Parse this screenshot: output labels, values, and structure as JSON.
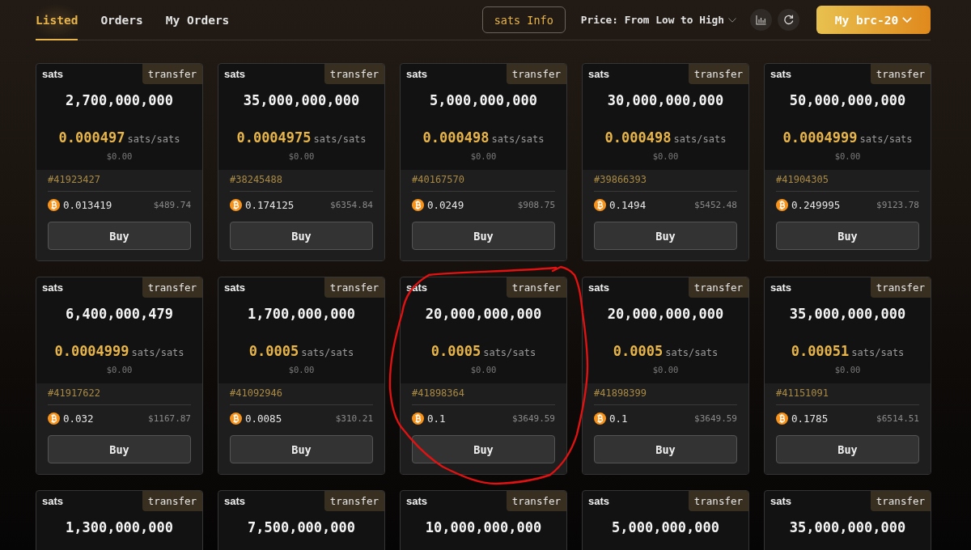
{
  "tabs": [
    {
      "label": "Listed",
      "selected": true
    },
    {
      "label": "Orders",
      "selected": false
    },
    {
      "label": "My Orders",
      "selected": false
    }
  ],
  "toolbar": {
    "info_button": "sats Info",
    "sort_label": "Price: From Low to High",
    "wallet_button": "My brc-20"
  },
  "cards": [
    {
      "ticker": "sats",
      "tag": "transfer",
      "amount": "2,700,000,000",
      "price": "0.000497",
      "unit": "sats/sats",
      "usd_price": "$0.00",
      "inscription": "#41923427",
      "btc_price": "0.013419",
      "usd_total": "$489.74",
      "button": "Buy",
      "annotated": false
    },
    {
      "ticker": "sats",
      "tag": "transfer",
      "amount": "35,000,000,000",
      "price": "0.0004975",
      "unit": "sats/sats",
      "usd_price": "$0.00",
      "inscription": "#38245488",
      "btc_price": "0.174125",
      "usd_total": "$6354.84",
      "button": "Buy",
      "annotated": false
    },
    {
      "ticker": "sats",
      "tag": "transfer",
      "amount": "5,000,000,000",
      "price": "0.000498",
      "unit": "sats/sats",
      "usd_price": "$0.00",
      "inscription": "#40167570",
      "btc_price": "0.0249",
      "usd_total": "$908.75",
      "button": "Buy",
      "annotated": false
    },
    {
      "ticker": "sats",
      "tag": "transfer",
      "amount": "30,000,000,000",
      "price": "0.000498",
      "unit": "sats/sats",
      "usd_price": "$0.00",
      "inscription": "#39866393",
      "btc_price": "0.1494",
      "usd_total": "$5452.48",
      "button": "Buy",
      "annotated": false
    },
    {
      "ticker": "sats",
      "tag": "transfer",
      "amount": "50,000,000,000",
      "price": "0.0004999",
      "unit": "sats/sats",
      "usd_price": "$0.00",
      "inscription": "#41904305",
      "btc_price": "0.249995",
      "usd_total": "$9123.78",
      "button": "Buy",
      "annotated": false
    },
    {
      "ticker": "sats",
      "tag": "transfer",
      "amount": "6,400,000,479",
      "price": "0.0004999",
      "unit": "sats/sats",
      "usd_price": "$0.00",
      "inscription": "#41917622",
      "btc_price": "0.032",
      "usd_total": "$1167.87",
      "button": "Buy",
      "annotated": false
    },
    {
      "ticker": "sats",
      "tag": "transfer",
      "amount": "1,700,000,000",
      "price": "0.0005",
      "unit": "sats/sats",
      "usd_price": "$0.00",
      "inscription": "#41092946",
      "btc_price": "0.0085",
      "usd_total": "$310.21",
      "button": "Buy",
      "annotated": false
    },
    {
      "ticker": "sats",
      "tag": "transfer",
      "amount": "20,000,000,000",
      "price": "0.0005",
      "unit": "sats/sats",
      "usd_price": "$0.00",
      "inscription": "#41898364",
      "btc_price": "0.1",
      "usd_total": "$3649.59",
      "button": "Buy",
      "annotated": true
    },
    {
      "ticker": "sats",
      "tag": "transfer",
      "amount": "20,000,000,000",
      "price": "0.0005",
      "unit": "sats/sats",
      "usd_price": "$0.00",
      "inscription": "#41898399",
      "btc_price": "0.1",
      "usd_total": "$3649.59",
      "button": "Buy",
      "annotated": false
    },
    {
      "ticker": "sats",
      "tag": "transfer",
      "amount": "35,000,000,000",
      "price": "0.00051",
      "unit": "sats/sats",
      "usd_price": "$0.00",
      "inscription": "#41151091",
      "btc_price": "0.1785",
      "usd_total": "$6514.51",
      "button": "Buy",
      "annotated": false
    },
    {
      "ticker": "sats",
      "tag": "transfer",
      "amount": "1,300,000,000",
      "annotated": false
    },
    {
      "ticker": "sats",
      "tag": "transfer",
      "amount": "7,500,000,000",
      "annotated": false
    },
    {
      "ticker": "sats",
      "tag": "transfer",
      "amount": "10,000,000,000",
      "annotated": false
    },
    {
      "ticker": "sats",
      "tag": "transfer",
      "amount": "5,000,000,000",
      "annotated": false
    },
    {
      "ticker": "sats",
      "tag": "transfer",
      "amount": "35,000,000,000",
      "annotated": false
    }
  ]
}
